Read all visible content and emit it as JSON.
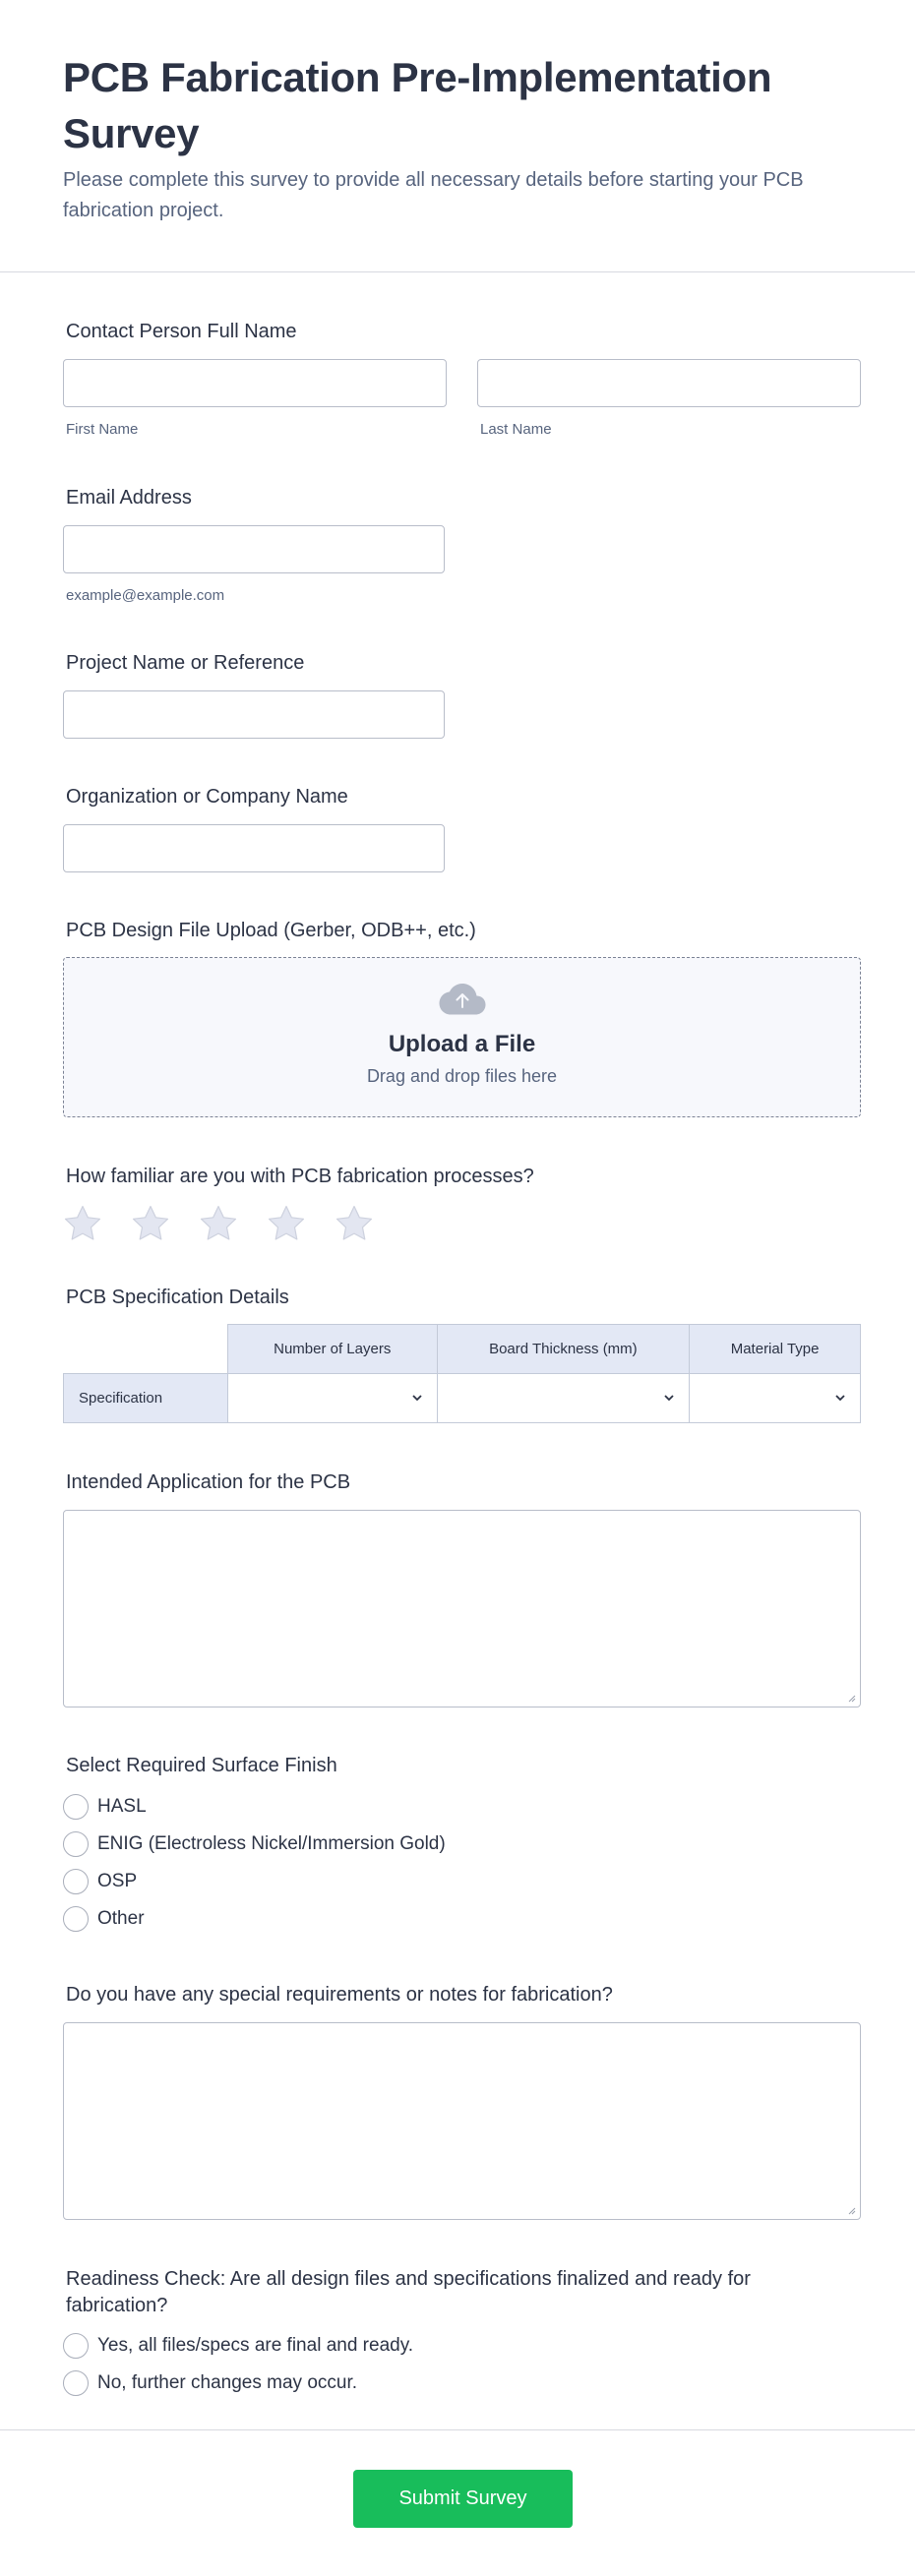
{
  "form": {
    "title": "PCB Fabrication Pre-Implementation Survey",
    "subtitle": "Please complete this survey to provide all necessary details before starting your PCB fabrication project."
  },
  "contact": {
    "label": "Contact Person Full Name",
    "first_name_value": "",
    "last_name_value": "",
    "first_sublabel": "First Name",
    "last_sublabel": "Last Name"
  },
  "email": {
    "label": "Email Address",
    "value": "",
    "sublabel": "example@example.com"
  },
  "project": {
    "label": "Project Name or Reference",
    "value": ""
  },
  "organization": {
    "label": "Organization or Company Name",
    "value": ""
  },
  "upload": {
    "label": "PCB Design File Upload (Gerber, ODB++, etc.)",
    "title": "Upload a File",
    "subtitle": "Drag and drop files here",
    "icon": "cloud-upload-icon"
  },
  "familiarity": {
    "label": "How familiar are you with PCB fabrication processes?",
    "rating": 0,
    "max": 5,
    "star_color": "#e3e6f1"
  },
  "spec": {
    "label": "PCB Specification Details",
    "columns": [
      "Number of Layers",
      "Board Thickness (mm)",
      "Material Type"
    ],
    "rows": [
      "Specification"
    ],
    "values": [
      "",
      "",
      ""
    ]
  },
  "application": {
    "label": "Intended Application for the PCB",
    "value": ""
  },
  "surface": {
    "label": "Select Required Surface Finish",
    "options": [
      "HASL",
      "ENIG (Electroless Nickel/Immersion Gold)",
      "OSP",
      "Other"
    ]
  },
  "notes": {
    "label": "Do you have any special requirements or notes for fabrication?",
    "value": ""
  },
  "readiness": {
    "label": "Readiness Check: Are all design files and specifications finalized and ready for fabrication?",
    "options": [
      "Yes, all files/specs are final and ready.",
      "No, further changes may occur."
    ]
  },
  "submit": {
    "label": "Submit Survey",
    "color": "#18bd5b"
  }
}
